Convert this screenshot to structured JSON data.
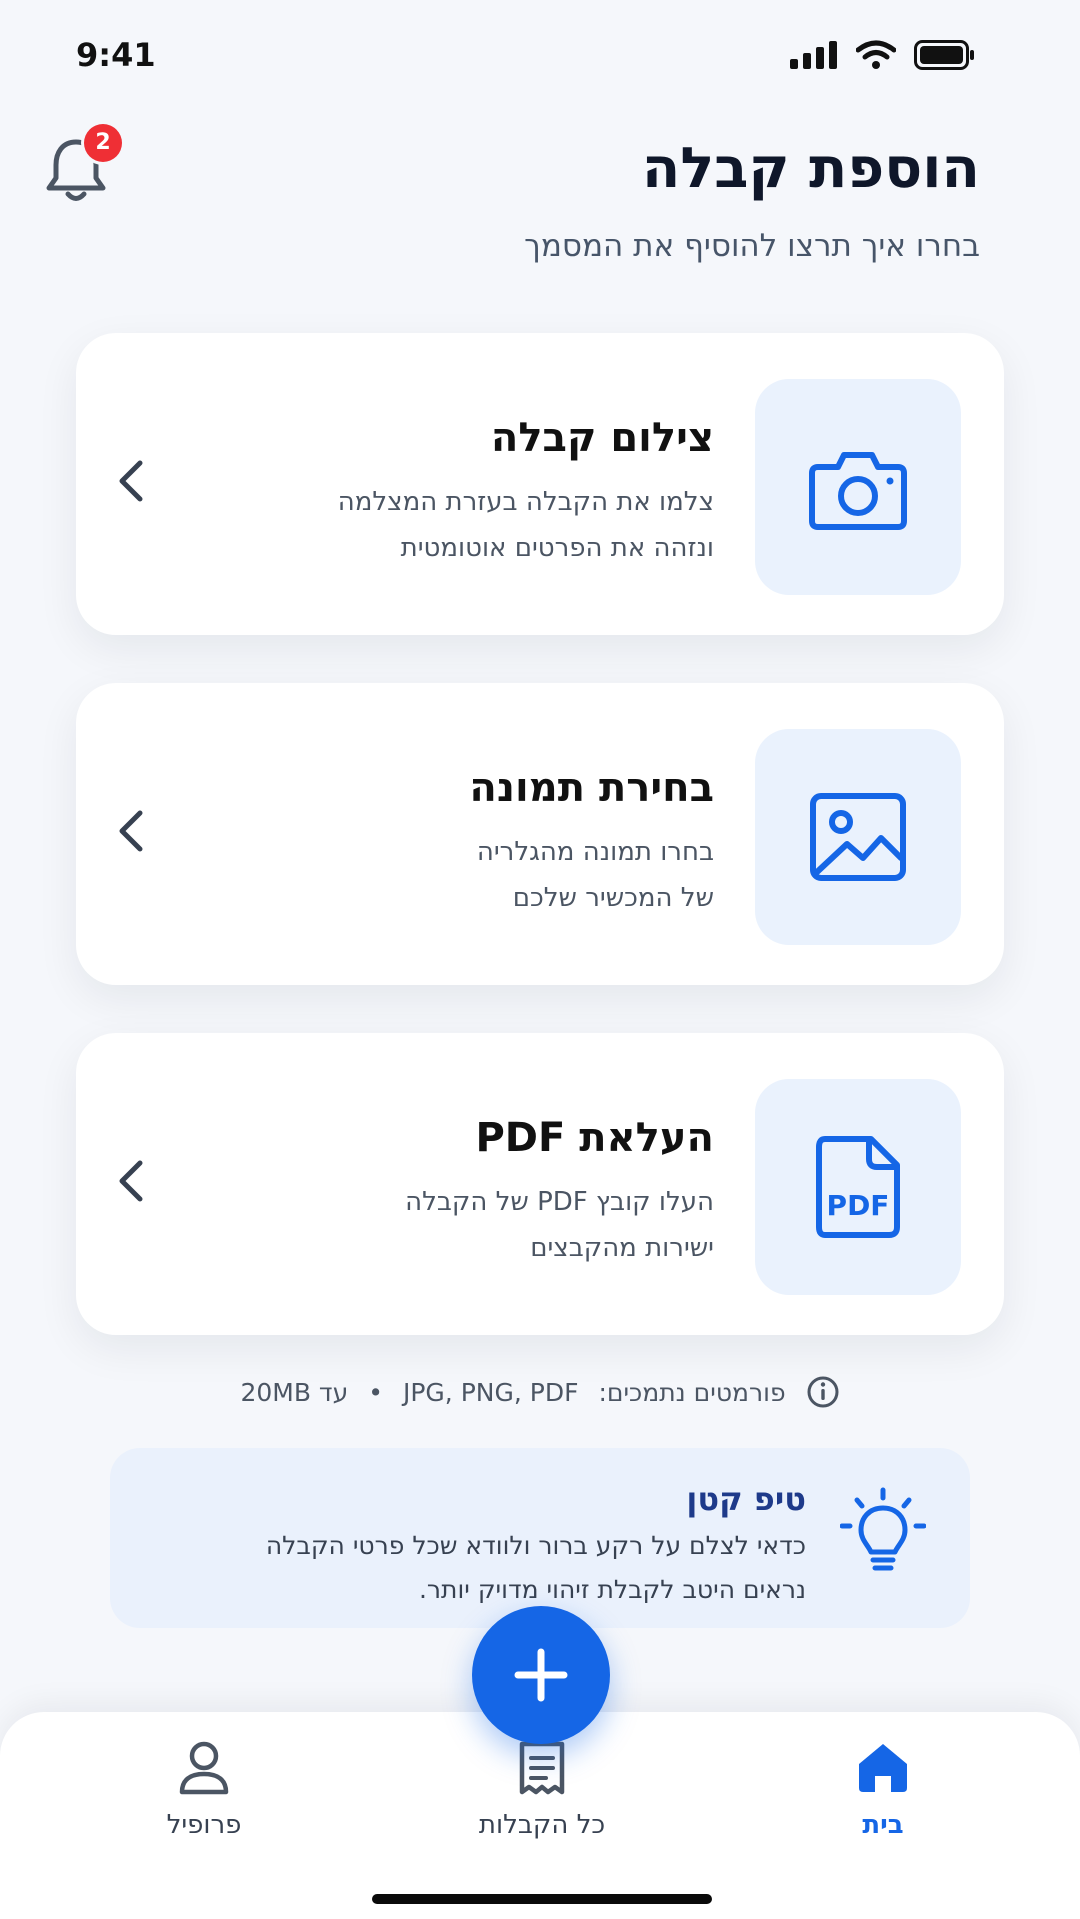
{
  "status_bar": {
    "time": "9:41"
  },
  "header": {
    "notification_count": "2",
    "title": "הוספת קבלה",
    "subtitle": "בחרו איך תרצו להוסיף את המסמך"
  },
  "options": [
    {
      "title": "צילום קבלה",
      "desc_line1": "צלמו את הקבלה בעזרת המצלמה",
      "desc_line2": "ונזהה את הפרטים אוטומטית",
      "icon": "camera-icon"
    },
    {
      "title": "בחירת תמונה",
      "desc_line1": "בחרו תמונה מהגלריה",
      "desc_line2": "של המכשיר שלכם",
      "icon": "image-icon"
    },
    {
      "title": "העלאת PDF",
      "desc_line1": "העלו קובץ PDF של הקבלה",
      "desc_line2": "ישירות מהקבצים",
      "icon": "pdf-file-icon",
      "icon_text": "PDF"
    }
  ],
  "formats": {
    "label": "פורמטים נתמכים:",
    "types": "JPG, PNG, PDF",
    "separator": "•",
    "limit": "עד 20MB"
  },
  "tip": {
    "title": "טיפ קטן",
    "line1": "כדאי לצלם על רקע ברור ולוודא שכל פרטי הקבלה",
    "line2": "נראים היטב לקבלת זיהוי מדויק יותר."
  },
  "tab_bar": {
    "home": "בית",
    "all_receipts": "כל הקבלות",
    "profile": "פרופיל"
  },
  "colors": {
    "accent": "#1566e6",
    "badge": "#ef2f35",
    "icon_box": "#eaf2fd",
    "tip_bg": "#eaf1fc"
  }
}
